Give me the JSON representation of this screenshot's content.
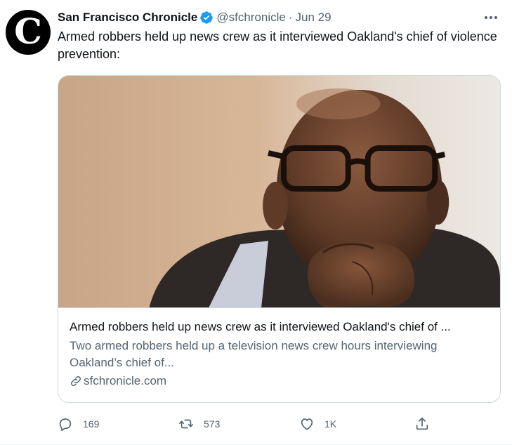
{
  "tweet": {
    "avatar_letter": "C",
    "display_name": "San Francisco Chronicle",
    "handle": "@sfchronicle",
    "separator": "·",
    "date": "Jun 29",
    "text": "Armed robbers held up news crew as it interviewed Oakland's chief of violence prevention:",
    "verified": true,
    "icons": {
      "verified": "verified-badge-icon",
      "more": "more-icon",
      "link": "link-icon",
      "reply": "reply-icon",
      "retweet": "retweet-icon",
      "like": "like-icon",
      "share": "share-icon"
    }
  },
  "card": {
    "title": "Armed robbers held up news crew as it interviewed Oakland's chief of ...",
    "description": "Two armed robbers held up a television news crew hours interviewing Oakland’s chief of...",
    "domain": "sfchronicle.com"
  },
  "actions": {
    "reply_count": "169",
    "retweet_count": "573",
    "like_count": "1K"
  },
  "colors": {
    "text_primary": "#0f1419",
    "text_secondary": "#536471",
    "verified_blue": "#1d9bf0",
    "border": "#cfd9de"
  }
}
